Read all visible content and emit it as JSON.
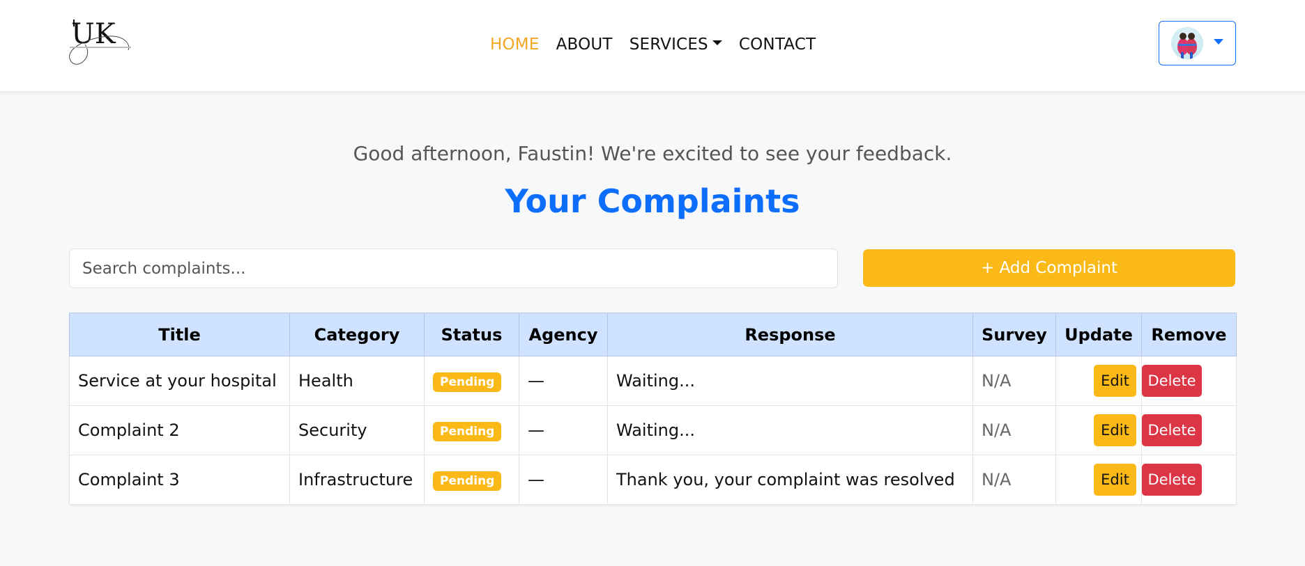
{
  "navbar": {
    "logo_text": "UK",
    "links": [
      {
        "label": "HOME",
        "active": true
      },
      {
        "label": "ABOUT",
        "active": false
      },
      {
        "label": "SERVICES",
        "active": false
      },
      {
        "label": "CONTACT",
        "active": false
      }
    ],
    "accent_color": "#f5a623"
  },
  "main": {
    "greeting": "Good afternoon, Faustin! We're excited to see your feedback.",
    "title": "Your Complaints",
    "search_placeholder": "Search complaints...",
    "add_button": "+ Add Complaint"
  },
  "table": {
    "headers": [
      "Title",
      "Category",
      "Status",
      "Agency",
      "Response",
      "Survey",
      "Update",
      "Remove"
    ],
    "rows": [
      {
        "title": "Service at your hospital",
        "category": "Health",
        "status": "Pending",
        "agency": "—",
        "response": "Waiting...",
        "survey": "N/A",
        "edit": "Edit",
        "delete": "Delete"
      },
      {
        "title": "Complaint 2",
        "category": "Security",
        "status": "Pending",
        "agency": "—",
        "response": "Waiting...",
        "survey": "N/A",
        "edit": "Edit",
        "delete": "Delete"
      },
      {
        "title": "Complaint 3",
        "category": "Infrastructure",
        "status": "Pending",
        "agency": "—",
        "response": "Thank you, your complaint was resolved",
        "survey": "N/A",
        "edit": "Edit",
        "delete": "Delete"
      }
    ]
  },
  "colors": {
    "primary": "#0d6efd",
    "warning": "#fbb917",
    "danger": "#dc3545",
    "table_header": "#cfe2ff"
  }
}
